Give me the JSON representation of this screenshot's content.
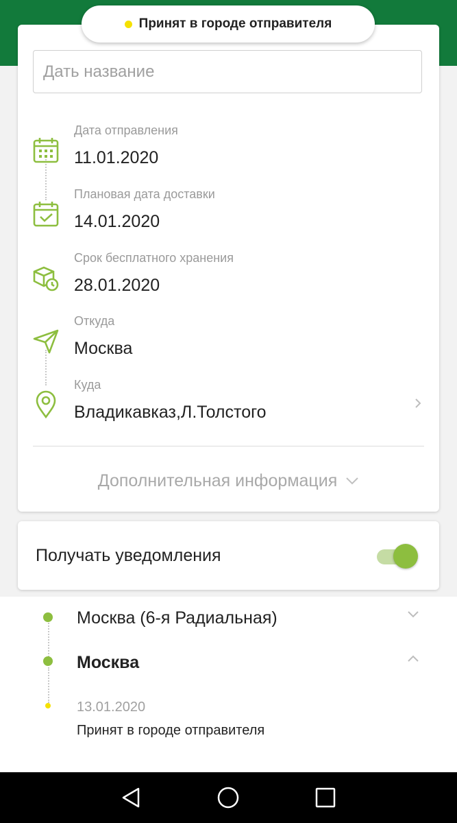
{
  "status_pill": {
    "text": "Принят в городе отправителя",
    "dot_color": "#f5e100"
  },
  "name_input": {
    "placeholder": "Дать название",
    "value": ""
  },
  "details": [
    {
      "label": "Дата отправления",
      "value": "11.01.2020",
      "icon": "calendar-icon"
    },
    {
      "label": "Плановая дата доставки",
      "value": "14.01.2020",
      "icon": "calendar-check-icon"
    },
    {
      "label": "Срок бесплатного хранения",
      "value": "28.01.2020",
      "icon": "box-clock-icon"
    },
    {
      "label": "Откуда",
      "value": "Москва",
      "icon": "send-arrow-icon"
    },
    {
      "label": "Куда",
      "value": "Владикавказ,Л.Толстого",
      "icon": "location-pin-icon"
    }
  ],
  "more_info": {
    "label": "Дополнительная информация"
  },
  "notifications": {
    "label": "Получать уведомления",
    "enabled": true
  },
  "history": [
    {
      "title": "Москва (6-я Радиальная)",
      "expanded": false
    },
    {
      "title": "Москва",
      "expanded": true,
      "events": [
        {
          "date": "13.01.2020",
          "status": "Принят в городе отправителя"
        }
      ]
    }
  ],
  "colors": {
    "brand_green": "#127a3b",
    "accent_green": "#8dbe3f",
    "status_yellow": "#f5e100"
  },
  "navbar": {
    "icons": [
      "back-icon",
      "home-icon",
      "recents-icon"
    ]
  }
}
